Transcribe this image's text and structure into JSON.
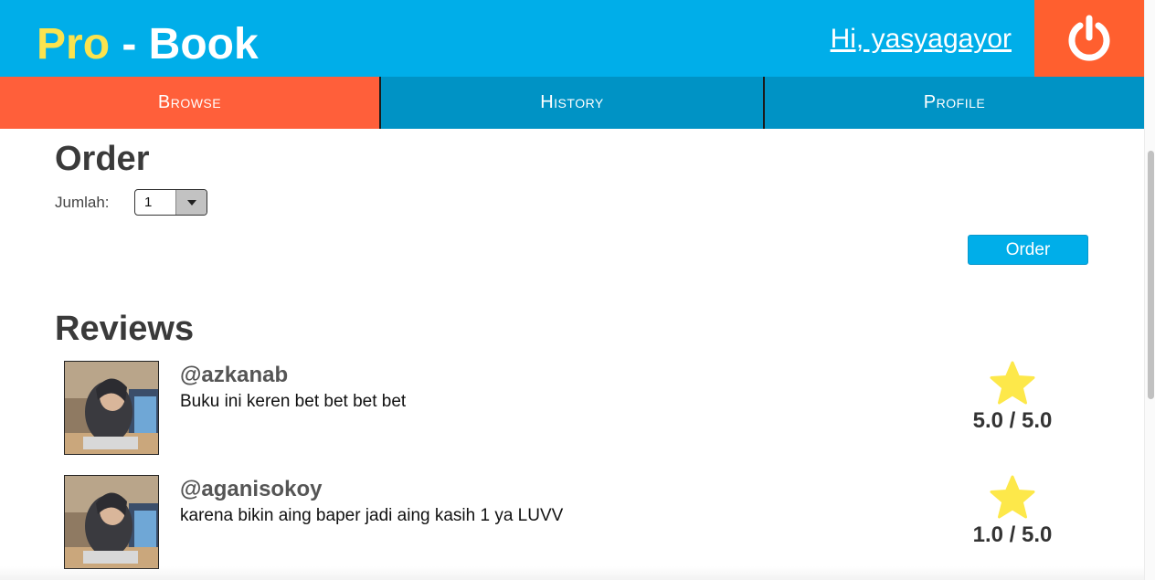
{
  "header": {
    "logo_pro": "Pro",
    "logo_rest": " - Book",
    "greeting": "Hi, yasyagayor",
    "logout_icon": "power-icon"
  },
  "nav": {
    "tabs": [
      {
        "label": "Browse",
        "active": true
      },
      {
        "label": "History",
        "active": false
      },
      {
        "label": "Profile",
        "active": false
      }
    ]
  },
  "order": {
    "title": "Order",
    "quantity_label": "Jumlah:",
    "quantity_value": "1",
    "button_label": "Order"
  },
  "reviews": {
    "title": "Reviews",
    "items": [
      {
        "username": "@azkanab",
        "comment": "Buku ini keren bet bet bet bet",
        "score": "5.0 / 5.0"
      },
      {
        "username": "@aganisokoy",
        "comment": "karena bikin aing baper jadi aing kasih 1 ya LUVV",
        "score": "1.0 / 5.0"
      }
    ]
  },
  "colors": {
    "header_bg": "#00aee9",
    "logo_accent": "#fbe34e",
    "logout_bg": "#ff5f2f",
    "active_tab": "#ff5f3a",
    "inactive_tab": "#0093c5",
    "star": "#fde84a"
  }
}
